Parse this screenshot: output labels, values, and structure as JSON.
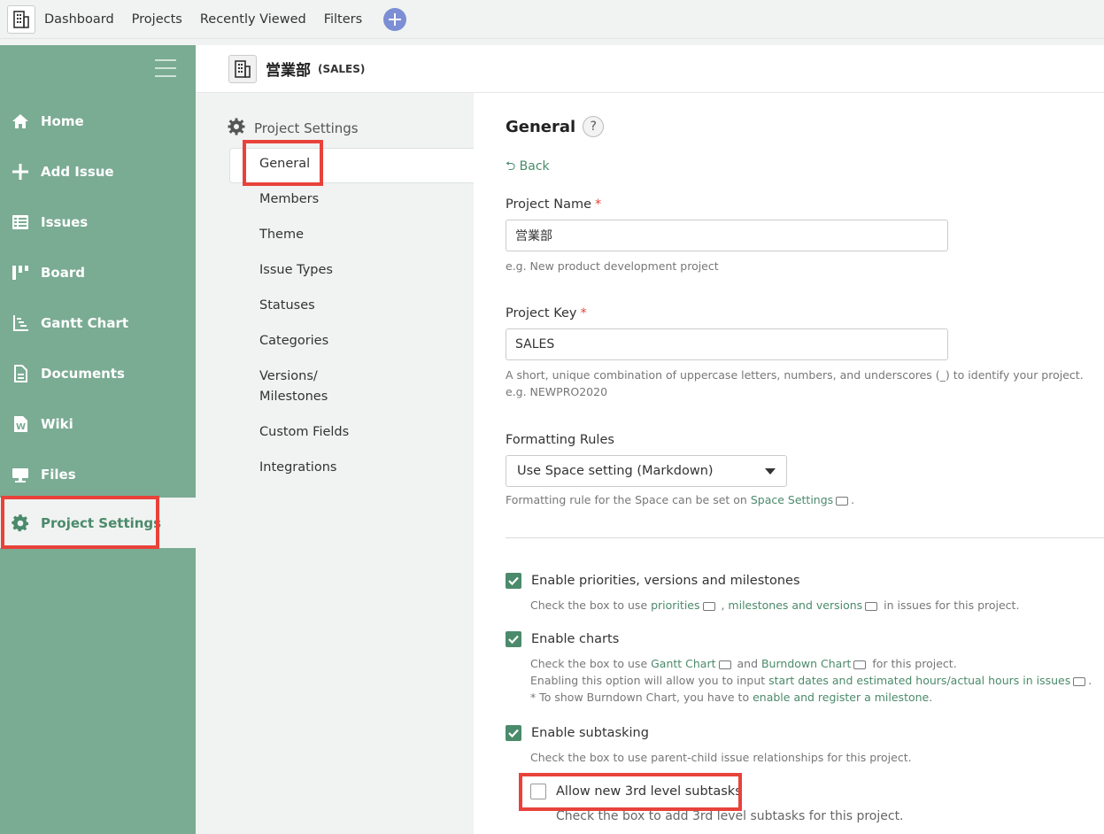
{
  "topnav": {
    "items": [
      "Dashboard",
      "Projects",
      "Recently Viewed",
      "Filters"
    ]
  },
  "sidebar": {
    "items": [
      {
        "label": "Home",
        "icon": "home-icon"
      },
      {
        "label": "Add Issue",
        "icon": "plus-icon"
      },
      {
        "label": "Issues",
        "icon": "list-icon"
      },
      {
        "label": "Board",
        "icon": "board-icon"
      },
      {
        "label": "Gantt Chart",
        "icon": "gantt-icon"
      },
      {
        "label": "Documents",
        "icon": "document-icon"
      },
      {
        "label": "Wiki",
        "icon": "wiki-icon"
      },
      {
        "label": "Files",
        "icon": "files-icon"
      },
      {
        "label": "Project Settings",
        "icon": "gear-icon",
        "active": true
      }
    ]
  },
  "project": {
    "name": "営業部",
    "key": "(SALES)"
  },
  "settings_menu": {
    "title": "Project Settings",
    "items": [
      "General",
      "Members",
      "Theme",
      "Issue Types",
      "Statuses",
      "Categories",
      "Versions/",
      "Milestones",
      "Custom Fields",
      "Integrations"
    ]
  },
  "main": {
    "title": "General",
    "help": "?",
    "back": "Back",
    "project_name_label": "Project Name",
    "required_mark": "*",
    "project_name_value": "営業部",
    "project_name_hint": "e.g. New product development project",
    "project_key_label": "Project Key",
    "project_key_value": "SALES",
    "project_key_hint_1": "A short, unique combination of uppercase letters, numbers, and underscores (_) to identify your project.",
    "project_key_hint_2": "e.g. NEWPRO2020",
    "formatting_label": "Formatting Rules",
    "formatting_value": "Use Space setting (Markdown)",
    "formatting_hint_pre": "Formatting rule for the Space can be set on ",
    "formatting_hint_link": "Space Settings",
    "formatting_hint_post": ".",
    "opt1": {
      "label": "Enable priorities, versions and milestones",
      "checked": true,
      "hint_pre": "Check the box to use ",
      "link1": "priorities",
      "mid": " , ",
      "link2": "milestones and versions",
      "hint_post": " in issues for this project."
    },
    "opt2": {
      "label": "Enable charts",
      "checked": true,
      "hint1_pre": "Check the box to use ",
      "link1": "Gantt Chart",
      "and": " and ",
      "link2": "Burndown Chart",
      "hint1_post": " for this project.",
      "hint2_pre": "Enabling this option will allow you to input ",
      "link3": "start dates and estimated hours/actual hours in issues",
      "hint2_post": ".",
      "hint3_pre": "* To show Burndown Chart, you have to ",
      "link4": "enable and register a milestone",
      "hint3_post": "."
    },
    "opt3": {
      "label": "Enable subtasking",
      "checked": true,
      "hint": "Check the box to use parent-child issue relationships for this project."
    },
    "opt4": {
      "label": "Allow new 3rd level subtasks",
      "checked": false,
      "hint": "Check the box to add 3rd level subtasks for this project."
    }
  },
  "colors": {
    "accent": "#4b8a6b",
    "sidebar": "#7aab93",
    "highlight": "#e8423a"
  }
}
